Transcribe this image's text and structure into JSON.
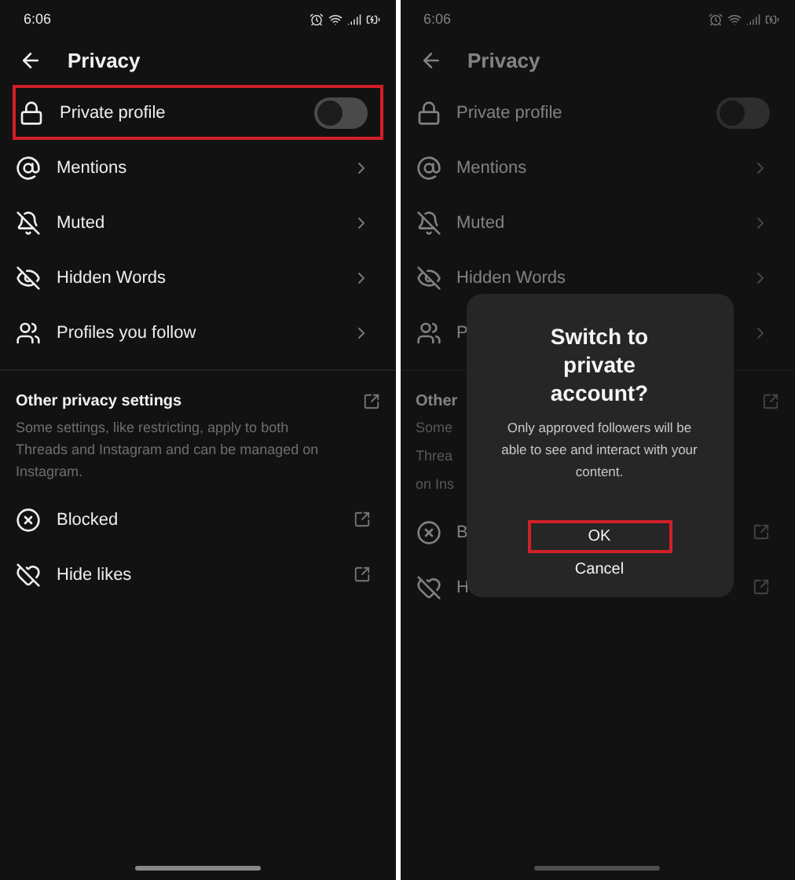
{
  "screens": [
    {
      "time": "6:06",
      "title": "Privacy",
      "dimmed": false,
      "rows": [
        {
          "kind": "toggle",
          "label": "Private profile",
          "on": false,
          "highlighted": true
        },
        {
          "kind": "link",
          "label": "Mentions",
          "highlighted": false
        },
        {
          "kind": "link",
          "label": "Muted",
          "highlighted": false
        },
        {
          "kind": "link",
          "label": "Hidden Words",
          "highlighted": false
        },
        {
          "kind": "link",
          "label": "Profiles you follow",
          "highlighted": false
        }
      ],
      "other": {
        "title": "Other privacy settings",
        "description": "Some settings, like restricting, apply to both Threads and Instagram and can be managed on Instagram."
      },
      "external_rows": [
        {
          "label": "Blocked"
        },
        {
          "label": "Hide likes"
        }
      ]
    },
    {
      "time": "6:06",
      "title": "Privacy",
      "dimmed": true,
      "rows": [
        {
          "kind": "toggle",
          "label": "Private profile",
          "on": false,
          "highlighted": false
        },
        {
          "kind": "link",
          "label": "Mentions",
          "highlighted": false
        },
        {
          "kind": "link",
          "label": "Muted",
          "highlighted": false
        },
        {
          "kind": "link",
          "label": "Hidden Words",
          "highlighted": false
        },
        {
          "kind": "link",
          "label": "P",
          "highlighted": false
        }
      ],
      "other": {
        "title": "Other",
        "description_lines": [
          "Some",
          "Threa",
          "on Ins"
        ]
      },
      "external_rows": [
        {
          "label": "B"
        },
        {
          "label": "H"
        }
      ],
      "dialog": {
        "title": "Switch to private account?",
        "message": "Only approved followers will be able to see and interact with your content.",
        "buttons": [
          {
            "label": "OK",
            "highlighted": true
          },
          {
            "label": "Cancel",
            "highlighted": false
          }
        ]
      }
    }
  ]
}
